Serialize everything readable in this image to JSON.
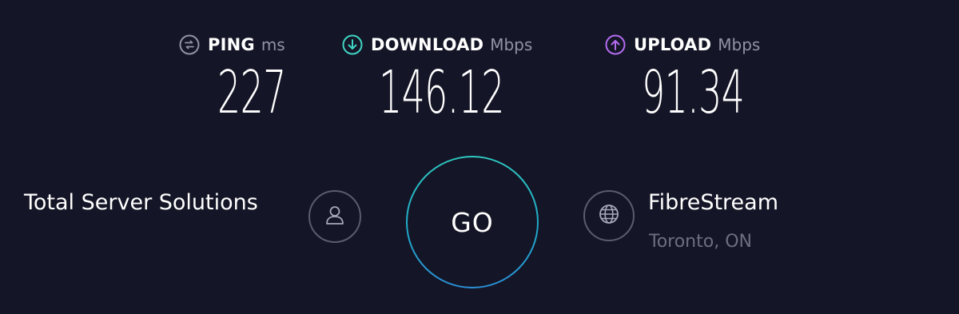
{
  "metrics": {
    "ping": {
      "label": "PING",
      "unit": "ms",
      "value": "227",
      "icon": "ping-icon",
      "color": "#9193a8"
    },
    "download": {
      "label": "DOWNLOAD",
      "unit": "Mbps",
      "value": "146.12",
      "icon": "download-arrow-icon",
      "color": "#3fd4c4"
    },
    "upload": {
      "label": "UPLOAD",
      "unit": "Mbps",
      "value": "91.34",
      "icon": "upload-arrow-icon",
      "color": "#b36cf0"
    }
  },
  "provider": {
    "name": "Total Server Solutions",
    "icon": "user-icon"
  },
  "go_button": {
    "label": "GO",
    "accent": "#21b3c9"
  },
  "server": {
    "name": "FibreStream",
    "location": "Toronto, ON",
    "icon": "globe-icon"
  },
  "colors": {
    "background": "#141526",
    "muted_text": "#6c6e82"
  }
}
